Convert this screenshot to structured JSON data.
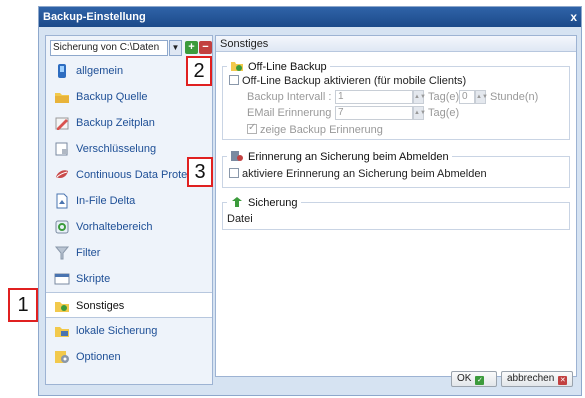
{
  "window": {
    "title": "Backup-Einstellung",
    "close": "x"
  },
  "left": {
    "source_select": "Sicherung von C:\\Daten",
    "nav": [
      {
        "label": "allgemein",
        "icon": "phone-icon"
      },
      {
        "label": "Backup Quelle",
        "icon": "folder-icon"
      },
      {
        "label": "Backup Zeitplan",
        "icon": "schedule-icon"
      },
      {
        "label": "Verschlüsselung",
        "icon": "lock-icon"
      },
      {
        "label": "Continuous Data Protection",
        "icon": "shield-icon"
      },
      {
        "label": "In-File Delta",
        "icon": "document-icon"
      },
      {
        "label": "Vorhaltebereich",
        "icon": "recycle-icon"
      },
      {
        "label": "Filter",
        "icon": "filter-icon"
      },
      {
        "label": "Skripte",
        "icon": "script-icon"
      },
      {
        "label": "Sonstiges",
        "icon": "misc-folder-icon",
        "active": true
      },
      {
        "label": "lokale Sicherung",
        "icon": "local-backup-icon"
      },
      {
        "label": "Optionen",
        "icon": "options-icon"
      }
    ]
  },
  "right": {
    "header": "Sonstiges",
    "offline": {
      "title": "Off-Line Backup",
      "enable_label": "Off-Line Backup aktivieren (für mobile Clients)",
      "interval_label": "Backup Intervall :",
      "interval_days": "1",
      "days_unit": "Tag(e)",
      "interval_hours": "0",
      "hours_unit": "Stunde(n)",
      "email_label": "EMail Erinnerung :",
      "email_days": "7",
      "email_unit": "Tag(e)",
      "show_reminder_label": "zeige Backup Erinnerung"
    },
    "logout": {
      "title": "Erinnerung an Sicherung beim Abmelden",
      "enable_label": "aktiviere Erinnerung an Sicherung beim Abmelden"
    },
    "security": {
      "title": "Sicherung",
      "value": "Datei"
    }
  },
  "buttons": {
    "ok": "OK",
    "cancel": "abbrechen"
  },
  "callouts": {
    "c1": "1",
    "c2": "2",
    "c3": "3"
  },
  "colors": {
    "title_bar": "#1c4a8a",
    "accent_link": "#1e4f96",
    "callout_border": "#e02020"
  }
}
